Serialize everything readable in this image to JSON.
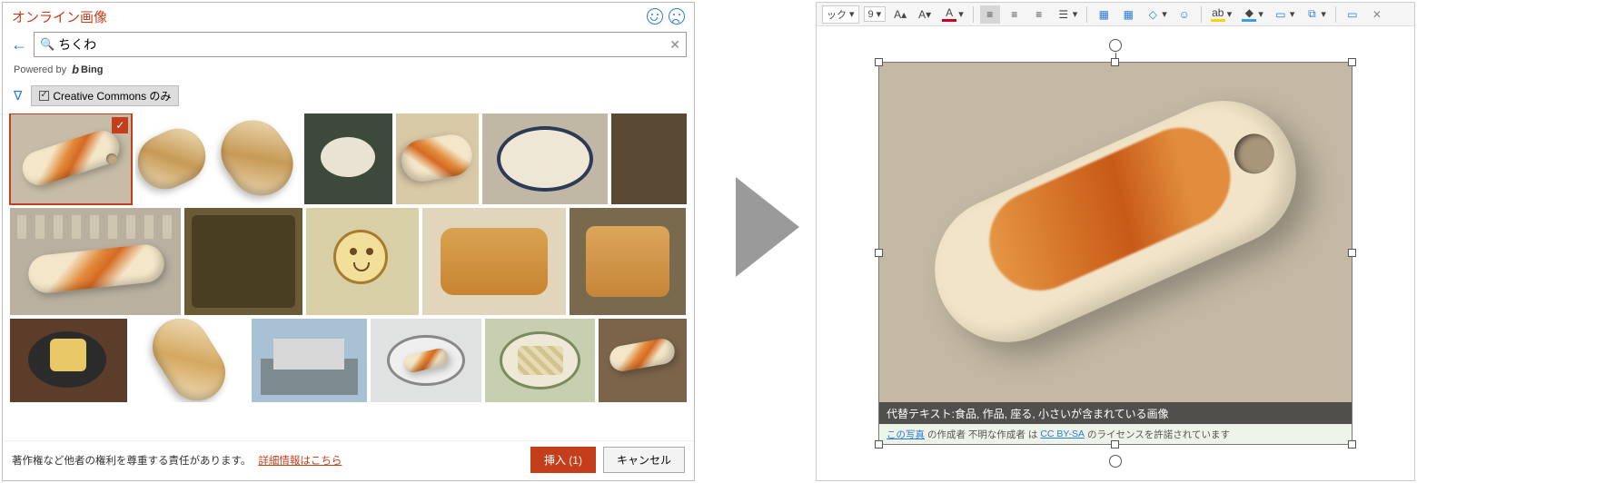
{
  "dialog": {
    "title": "オンライン画像",
    "search_value": "ちくわ",
    "powered_by": "Powered by",
    "bing_label": "Bing",
    "cc_filter_label": "Creative Commons のみ",
    "copyright_notice": "著作権など他者の権利を尊重する責任があります。",
    "more_info_link": "詳細情報はこちら",
    "insert_button": "挿入 (1)",
    "cancel_button": "キャンセル"
  },
  "editor": {
    "font_size": "9",
    "font_style_label": "ック",
    "alt_text_label": "代替テキスト:",
    "alt_text_value": "食品, 作品, 座る, 小さいが含まれている画像",
    "attrib_prefix": "この写真",
    "attrib_mid": " の作成者 不明な作成者 は ",
    "attrib_license": "CC BY-SA",
    "attrib_suffix": " のライセンスを許諾されています"
  }
}
